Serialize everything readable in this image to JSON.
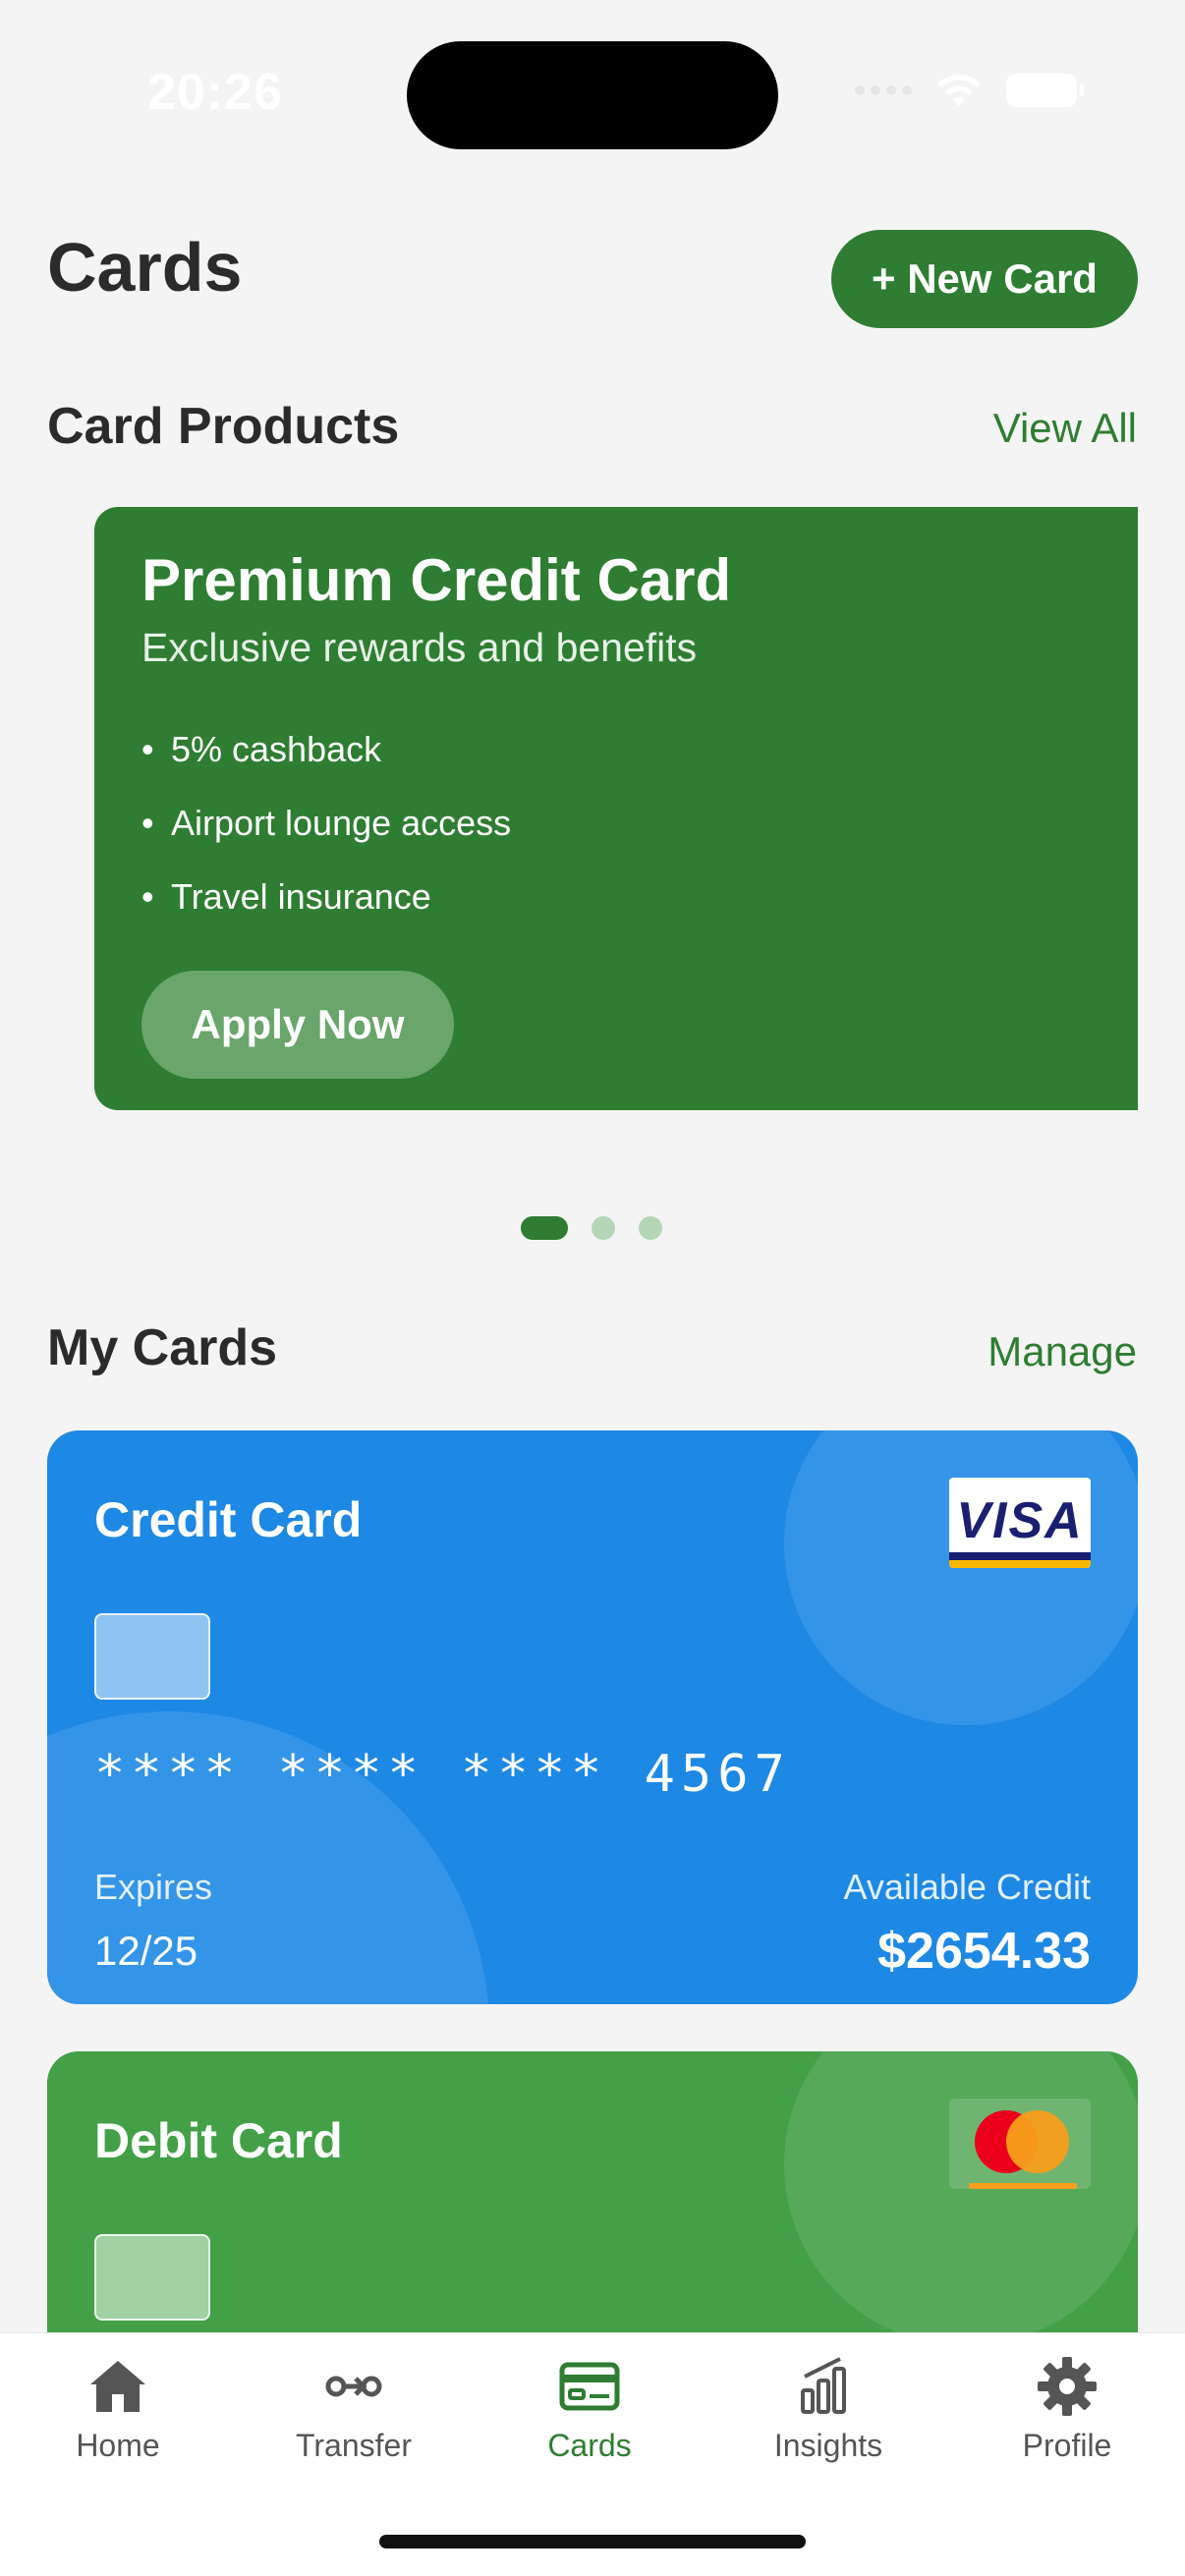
{
  "status_bar": {
    "time": "20:26"
  },
  "header": {
    "title": "Cards",
    "new_card_label": "+ New Card"
  },
  "card_products": {
    "section_title": "Card Products",
    "view_all_label": "View All",
    "product": {
      "title": "Premium Credit Card",
      "subtitle": "Exclusive rewards and benefits",
      "features": [
        "5% cashback",
        "Airport lounge access",
        "Travel insurance"
      ],
      "cta_label": "Apply Now"
    },
    "carousel": {
      "total": 3,
      "active_index": 0
    }
  },
  "my_cards": {
    "section_title": "My Cards",
    "manage_label": "Manage",
    "cards": [
      {
        "name": "Credit Card",
        "brand": "visa",
        "brand_label": "VISA",
        "number": "**** **** **** 4567",
        "expires_label": "Expires",
        "expires": "12/25",
        "credit_label": "Available Credit",
        "credit": "$2654.33",
        "color": "#1e88e5"
      },
      {
        "name": "Debit Card",
        "brand": "mastercard",
        "color": "#43a047"
      }
    ]
  },
  "bottom_nav": {
    "items": [
      {
        "label": "Home",
        "icon": "home-icon"
      },
      {
        "label": "Transfer",
        "icon": "transfer-icon"
      },
      {
        "label": "Cards",
        "icon": "card-icon",
        "active": true
      },
      {
        "label": "Insights",
        "icon": "bar-chart-icon"
      },
      {
        "label": "Profile",
        "icon": "gear-icon"
      }
    ]
  },
  "colors": {
    "accent": "#2e7d32",
    "credit_card": "#1e88e5",
    "debit_card": "#43a047",
    "background": "#f4f4f4"
  }
}
